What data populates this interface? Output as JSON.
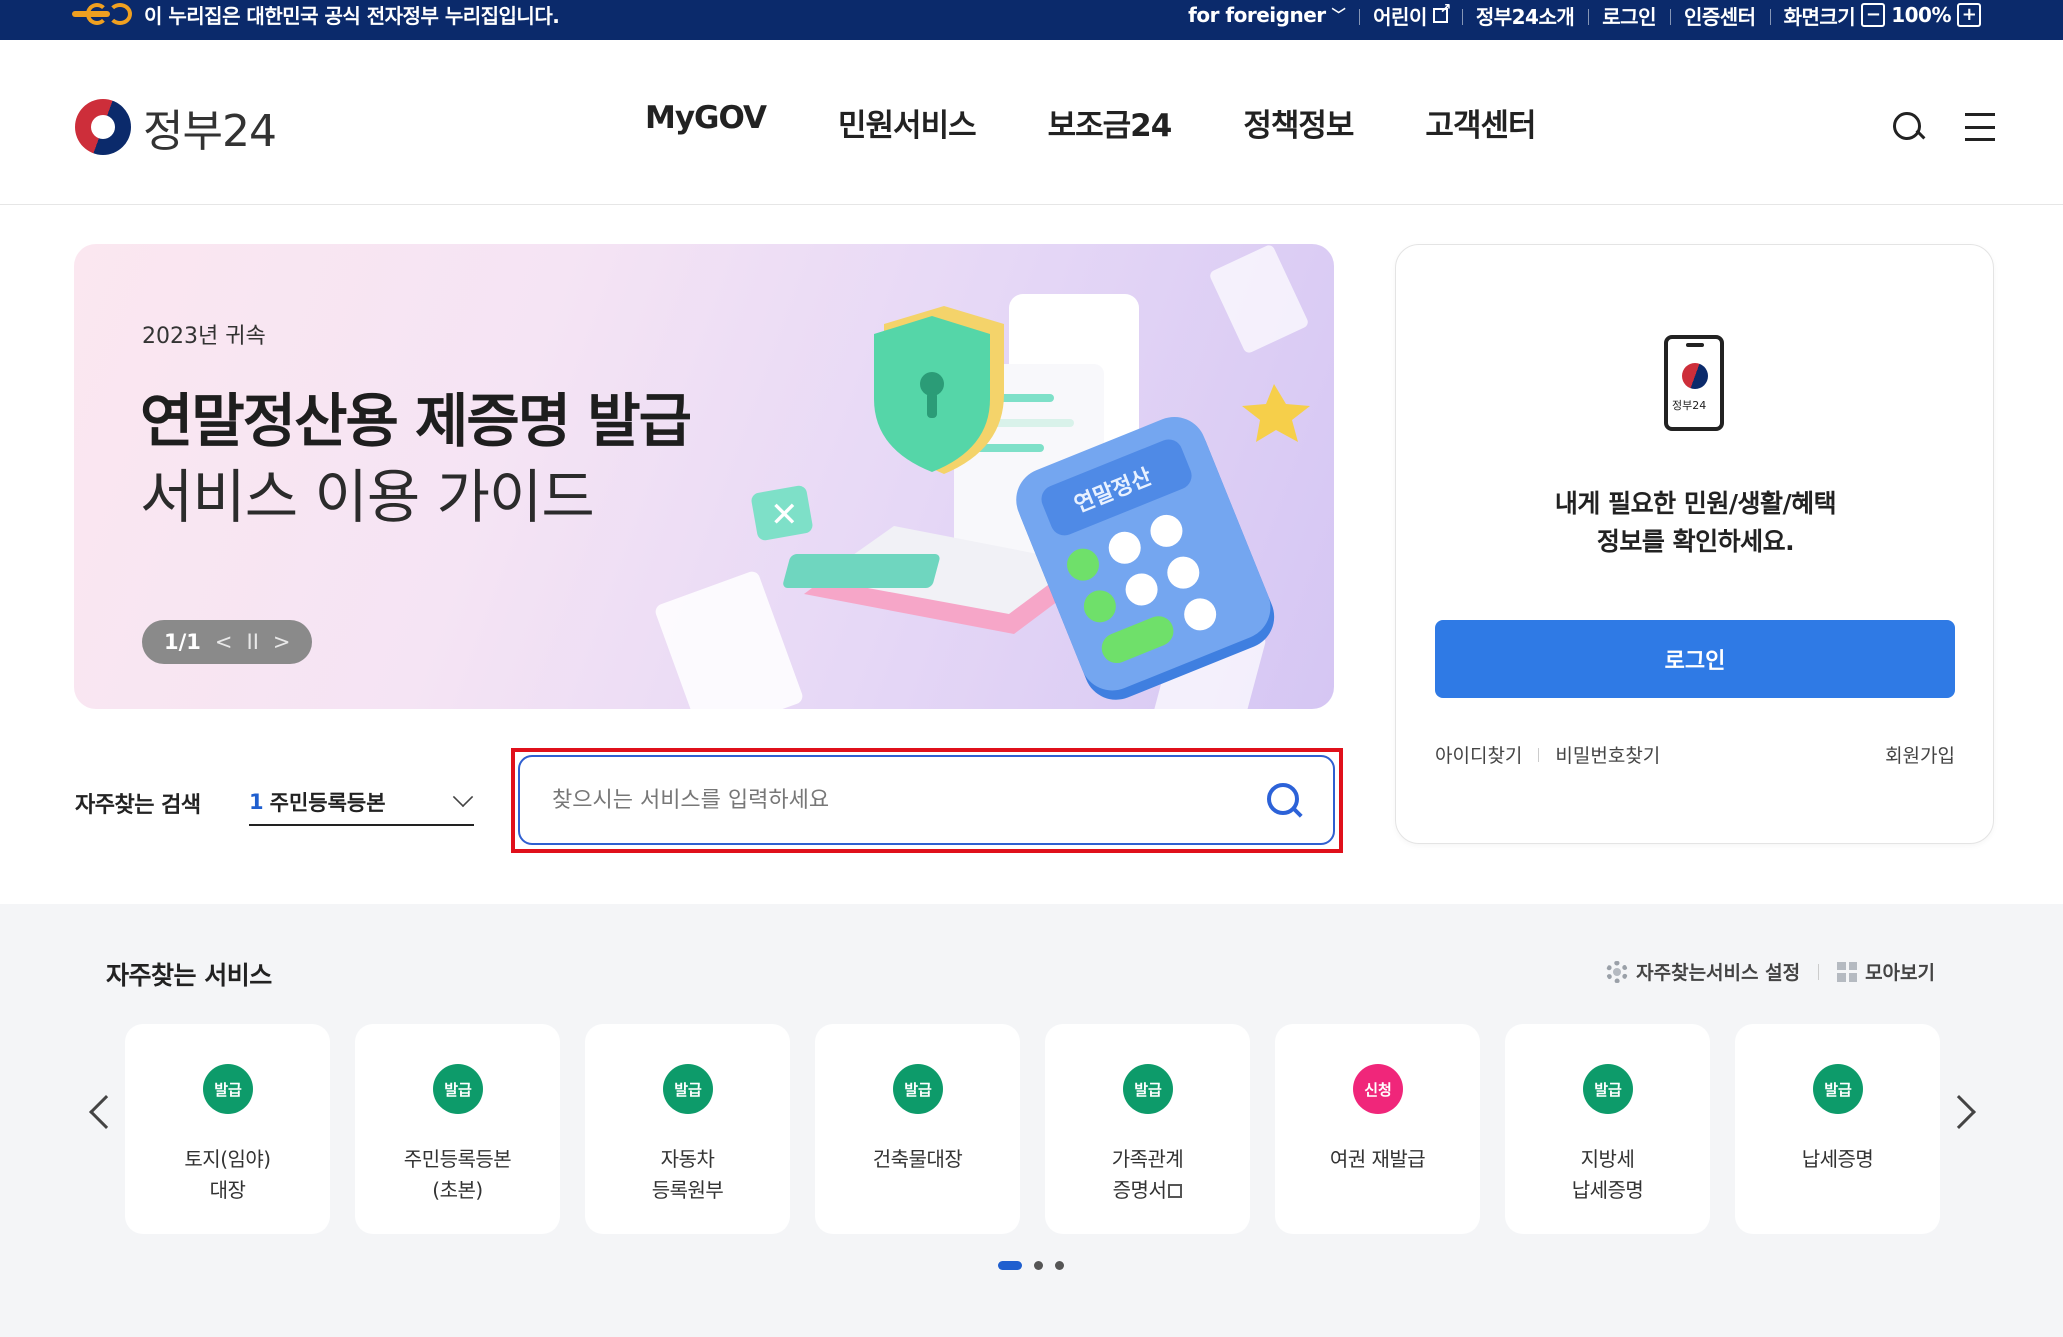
{
  "topbar": {
    "notice": "이 누리집은 대한민국 공식 전자정부 누리집입니다.",
    "for_foreigner": "for foreigner",
    "kids": "어린이",
    "about": "정부24소개",
    "login": "로그인",
    "cert_center": "인증센터",
    "screen_size": "화면크기",
    "zoom_minus": "−",
    "zoom_value": "100%",
    "zoom_plus": "+"
  },
  "header": {
    "logo_text": "정부24",
    "nav": [
      "MyGOV",
      "민원서비스",
      "보조금24",
      "정책정보",
      "고객센터"
    ]
  },
  "banner": {
    "eyebrow": "2023년 귀속",
    "title_line1": "연말정산용 제증명 발급",
    "title_line2": "서비스 이용 가이드",
    "calculator_text": "연말정산",
    "pager": "1/1",
    "prev": "<",
    "pause": "II",
    "next": ">"
  },
  "login_card": {
    "phone_label": "정부24",
    "message_line1": "내게 필요한 민원/생활/혜택",
    "message_line2": "정보를 확인하세요.",
    "login_button": "로그인",
    "find_id": "아이디찾기",
    "find_pw": "비밀번호찾기",
    "signup": "회원가입"
  },
  "search": {
    "freq_label": "자주찾는 검색",
    "freq_rank": "1",
    "freq_item": "주민등록등본",
    "placeholder": "찾으시는 서비스를 입력하세요"
  },
  "services": {
    "title": "자주찾는 서비스",
    "settings": "자주찾는서비스 설정",
    "view_all": "모아보기",
    "cards": [
      {
        "badge": "발급",
        "label": "토지(임야)\n대장"
      },
      {
        "badge": "발급",
        "label": "주민등록등본\n(초본)"
      },
      {
        "badge": "발급",
        "label": "자동차\n등록원부"
      },
      {
        "badge": "발급",
        "label": "건축물대장"
      },
      {
        "badge": "발급",
        "label": "가족관계\n증명서"
      },
      {
        "badge": "신청",
        "label": "여권 재발급"
      },
      {
        "badge": "발급",
        "label": "지방세\n납세증명"
      },
      {
        "badge": "발급",
        "label": "납세증명"
      }
    ]
  },
  "colors": {
    "topbar": "#0b2a6b",
    "login_button": "#2f7ae5",
    "badge_issue": "#0d9b6a",
    "badge_apply": "#f0267a",
    "highlight": "#e0101b"
  }
}
